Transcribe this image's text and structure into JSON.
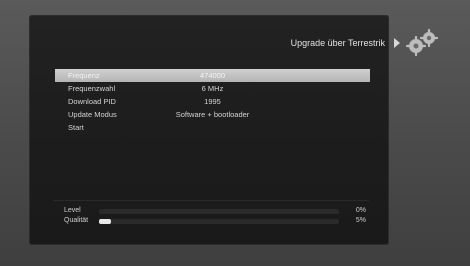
{
  "header": {
    "title": "Upgrade über Terrestrik",
    "icon": "gears-icon",
    "arrow_icon": "arrow-right-icon"
  },
  "menu": {
    "items": [
      {
        "label": "Frequenz",
        "value": "474000",
        "selected": true
      },
      {
        "label": "Frequenzwahl",
        "value": "6 MHz"
      },
      {
        "label": "Download PID",
        "value": "1995"
      },
      {
        "label": "Update Modus",
        "value": "Software + bootloader"
      },
      {
        "label": "Start",
        "value": ""
      }
    ]
  },
  "signal": {
    "level": {
      "label": "Level",
      "value": "0%",
      "fraction": 0.0
    },
    "quality": {
      "label": "Qualität",
      "value": "5%",
      "fraction": 0.05
    }
  },
  "colors": {
    "selection": "#c4c4c4",
    "panel": "#1e1e1e",
    "bar_fill": "#e8e8e8"
  }
}
